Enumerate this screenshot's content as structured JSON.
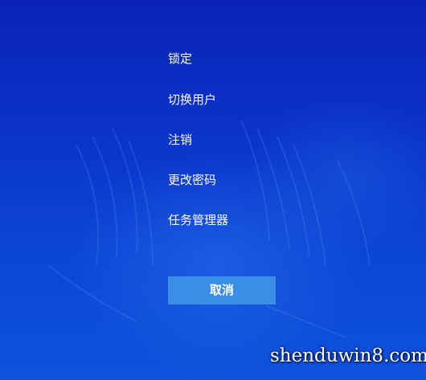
{
  "menu": {
    "items": [
      {
        "label": "锁定"
      },
      {
        "label": "切换用户"
      },
      {
        "label": "注销"
      },
      {
        "label": "更改密码"
      },
      {
        "label": "任务管理器"
      }
    ]
  },
  "cancel_button": {
    "label": "取消"
  },
  "watermark": {
    "text": "shenduwin8.com"
  },
  "colors": {
    "background": "#0c3bd0",
    "button": "#3b8ee6",
    "text": "#ffffff"
  }
}
